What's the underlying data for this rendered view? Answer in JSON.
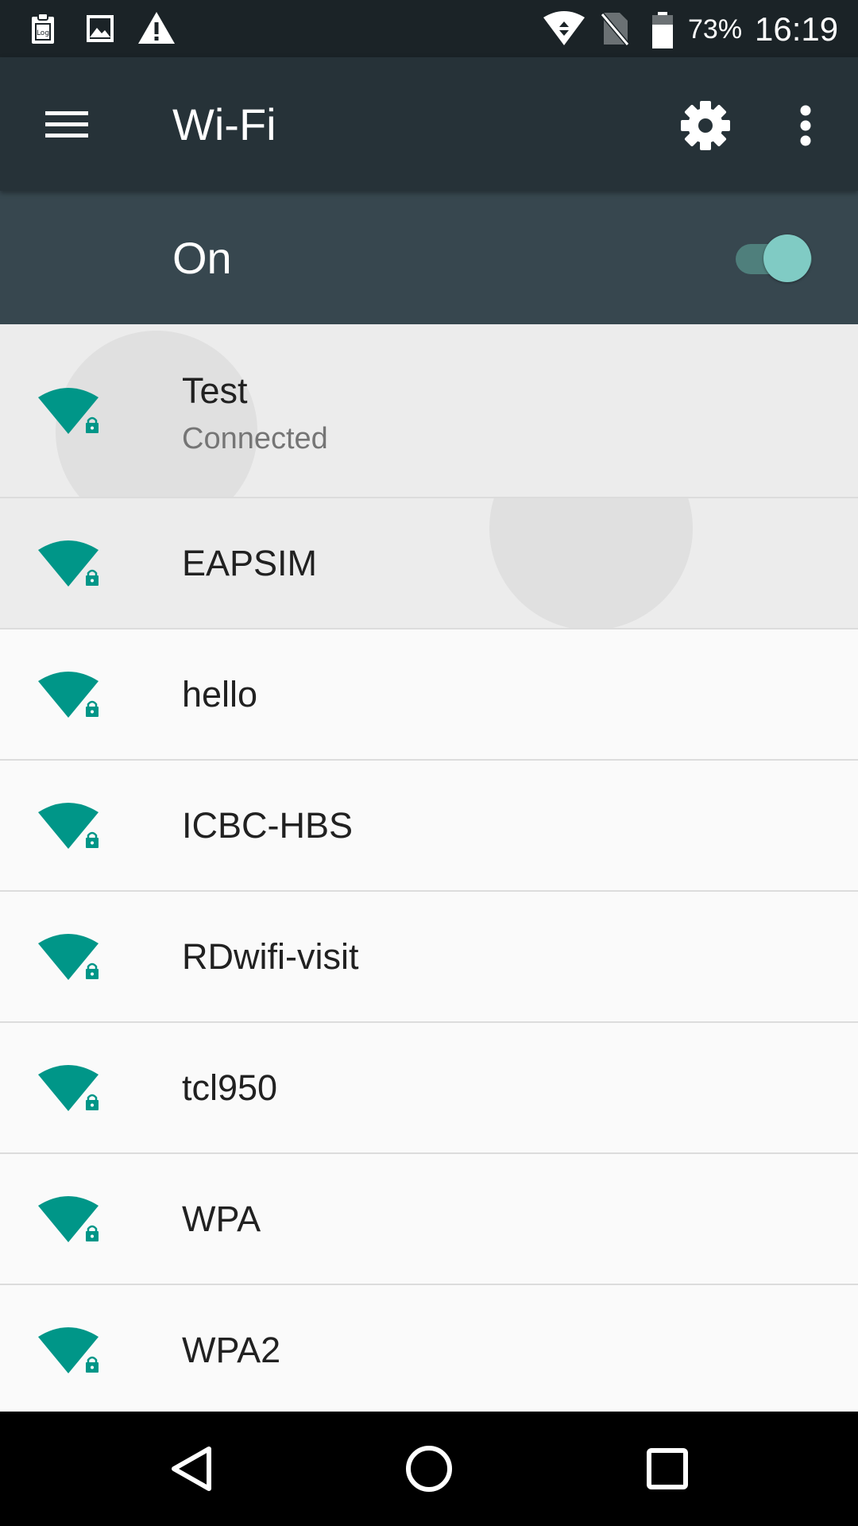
{
  "status_bar": {
    "battery_percent": "73%",
    "time": "16:19",
    "icons": [
      "log-notification-icon",
      "image-notification-icon",
      "warning-icon",
      "wifi-signal-icon",
      "no-sim-icon",
      "battery-icon"
    ]
  },
  "app_bar": {
    "title": "Wi-Fi",
    "icons": [
      "menu-icon",
      "gear-icon",
      "more-vert-icon"
    ]
  },
  "switch_bar": {
    "label": "On",
    "enabled": true
  },
  "networks": [
    {
      "name": "Test",
      "status": "Connected",
      "secured": true
    },
    {
      "name": "EAPSIM",
      "secured": true
    },
    {
      "name": "hello",
      "secured": true
    },
    {
      "name": "ICBC-HBS",
      "secured": true
    },
    {
      "name": "RDwifi-visit",
      "secured": true
    },
    {
      "name": "tcl950",
      "secured": true
    },
    {
      "name": "WPA",
      "secured": true
    },
    {
      "name": "WPA2",
      "secured": true
    }
  ],
  "nav_bar": {
    "icons": [
      "back-icon",
      "home-icon",
      "recents-icon"
    ]
  },
  "colors": {
    "status_bar": "#1b2327",
    "app_bar": "#263238",
    "switch_bar": "#37474f",
    "accent": "#009688",
    "toggle_thumb": "#80cbc4"
  }
}
